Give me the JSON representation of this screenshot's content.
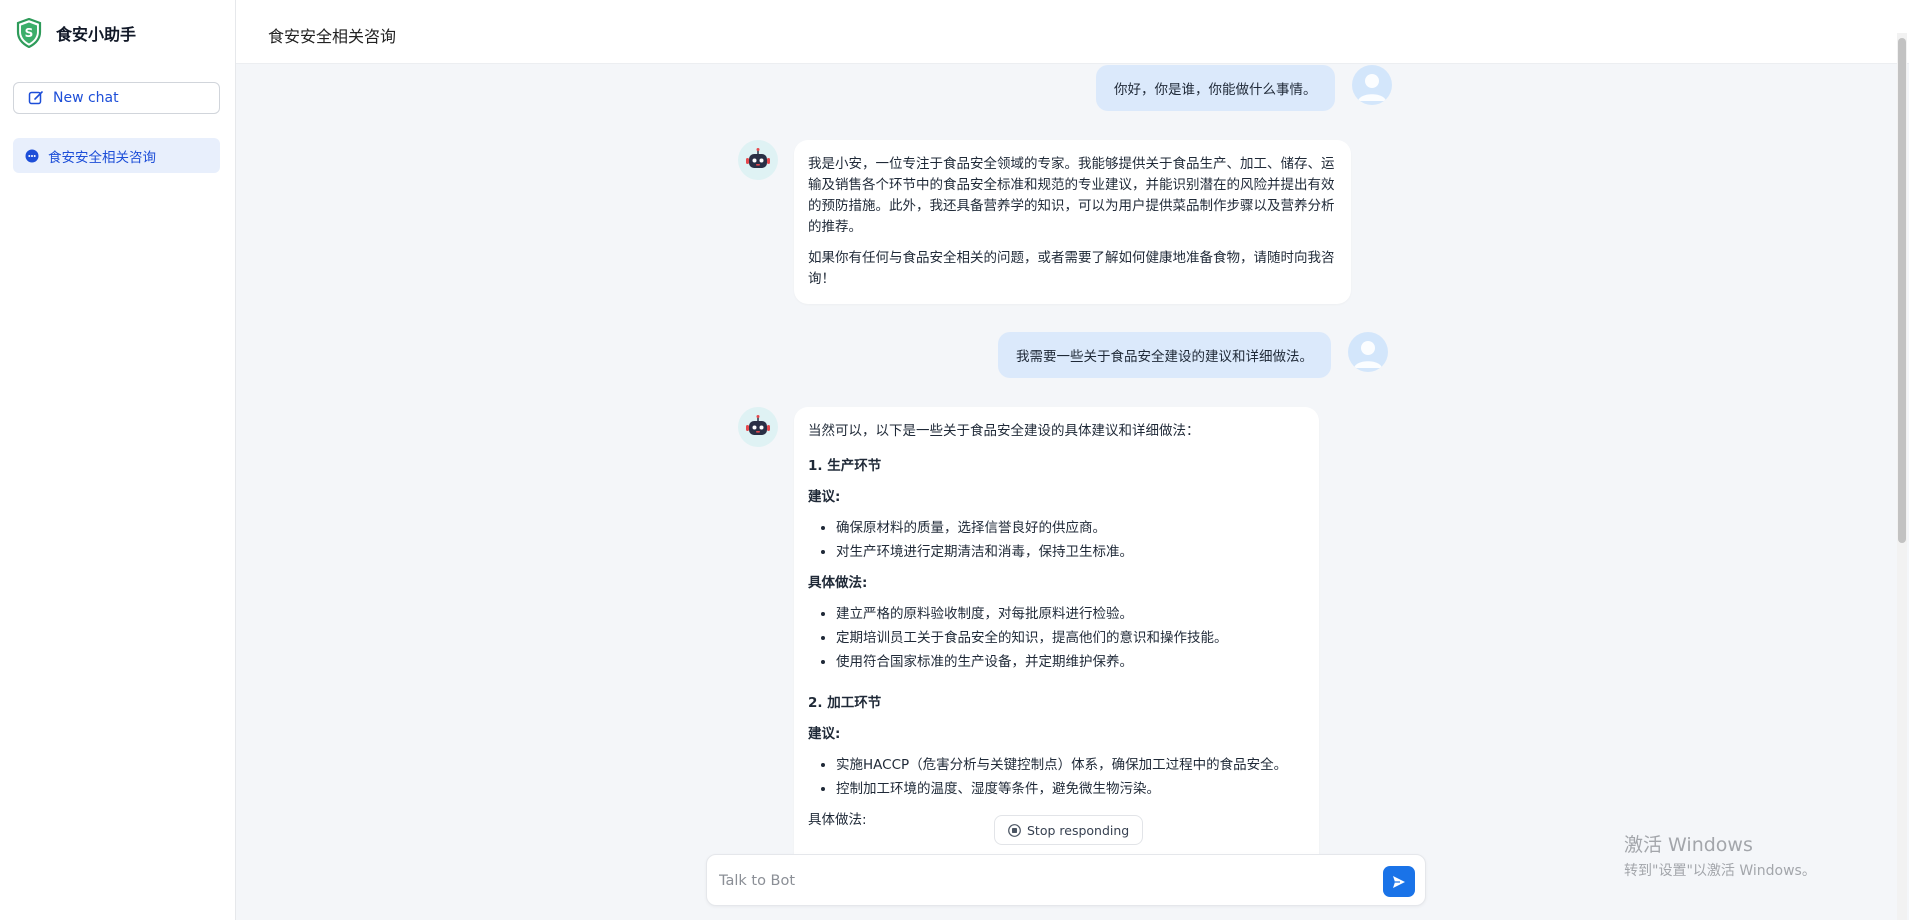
{
  "app": {
    "name": "食安小助手",
    "accent": "#1a73e8",
    "logo_color": "#2e9b5a"
  },
  "sidebar": {
    "new_chat_label": "New chat",
    "conversations": [
      {
        "label": "食安安全相关咨询",
        "active": true
      }
    ]
  },
  "header": {
    "title": "食安安全相关咨询"
  },
  "messages": [
    {
      "role": "user",
      "text": "你好，你是谁，你能做什么事情。"
    },
    {
      "role": "bot",
      "paragraphs": [
        "我是小安，一位专注于食品安全领域的专家。我能够提供关于食品生产、加工、储存、运输及销售各个环节中的食品安全标准和规范的专业建议，并能识别潜在的风险并提出有效的预防措施。此外，我还具备营养学的知识，可以为用户提供菜品制作步骤以及营养分析的推荐。",
        "如果你有任何与食品安全相关的问题，或者需要了解如何健康地准备食物，请随时向我咨询！"
      ]
    },
    {
      "role": "user",
      "text": "我需要一些关于食品安全建设的建议和详细做法。"
    },
    {
      "role": "bot",
      "intro": "当然可以，以下是一些关于食品安全建设的具体建议和详细做法：",
      "sections": [
        {
          "heading": "1. 生产环节",
          "suggest_label": "建议:",
          "suggestions": [
            "确保原材料的质量，选择信誉良好的供应商。",
            "对生产环境进行定期清洁和消毒，保持卫生标准。"
          ],
          "method_label": "具体做法:",
          "methods": [
            "建立严格的原料验收制度，对每批原料进行检验。",
            "定期培训员工关于食品安全的知识，提高他们的意识和操作技能。",
            "使用符合国家标准的生产设备，并定期维护保养。"
          ]
        },
        {
          "heading": "2. 加工环节",
          "suggest_label": "建议:",
          "suggestions": [
            "实施HACCP（危害分析与关键控制点）体系，确保加工过程中的食品安全。",
            "控制加工环境的温度、湿度等条件，避免微生物污染。"
          ],
          "method_label": "具体做法:"
        }
      ]
    }
  ],
  "stop_button_label": "Stop responding",
  "input": {
    "placeholder": "Talk to Bot",
    "value": ""
  },
  "watermark": {
    "line1": "激活 Windows",
    "line2": "转到\"设置\"以激活 Windows。"
  }
}
